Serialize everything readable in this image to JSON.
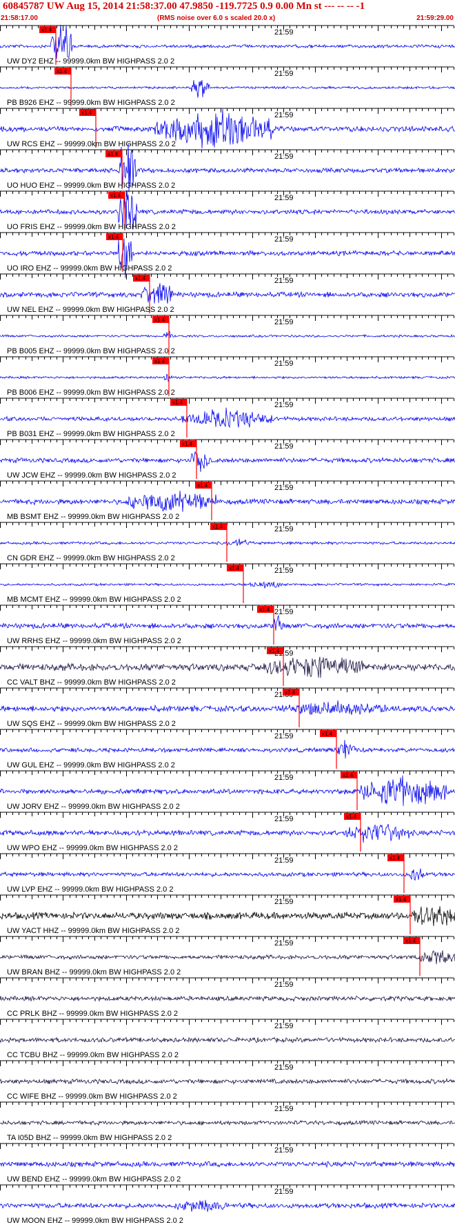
{
  "header": {
    "title": "60845787 UW Aug 15, 2014 21:58:37.00   47.9850 -119.7725  0.9 0.00 Mn st --- -- --  -1",
    "start_time": "21:58:17.00",
    "note": "(RMS noise over 6.0 s scaled 20.0 x)",
    "end_time": "21:59:29.00"
  },
  "colors": {
    "trace_blue": "#0000ee",
    "trace_dark": "#1a1040",
    "trace_black": "#000000",
    "pick_red": "#ff0000",
    "header_red": "#d40000"
  },
  "chart_data": {
    "type": "line",
    "time_marker": "21:59",
    "scale_label": "x1.4",
    "traces": [
      {
        "label": "UW DY2 EHZ -- 99999.0km BW  HIGHPASS  2.0  2",
        "pick_frac": 0.123,
        "burst": [
          0.11,
          0.16,
          2.2
        ],
        "noise": 0.14,
        "color": "blue"
      },
      {
        "label": "PB B926 EHZ -- 99999.0km BW  HIGHPASS  2.0  2",
        "pick_frac": 0.156,
        "burst": [
          0.42,
          0.46,
          1.0
        ],
        "noise": 0.1,
        "color": "blue"
      },
      {
        "label": "UW RCS EHZ -- 99999.0km BW  HIGHPASS  2.0  2",
        "pick_frac": 0.212,
        "burst": [
          0.34,
          0.6,
          1.8
        ],
        "noise": 0.22,
        "color": "blue"
      },
      {
        "label": "UO HUO EHZ -- 99999.0km BW  HIGHPASS  2.0  2",
        "pick_frac": 0.269,
        "burst": [
          0.26,
          0.3,
          3.0
        ],
        "noise": 0.2,
        "color": "blue"
      },
      {
        "label": "UO FRIS EHZ -- 99999.0km BW  HIGHPASS  2.0  2",
        "pick_frac": 0.275,
        "burst": [
          0.26,
          0.3,
          3.0
        ],
        "noise": 0.2,
        "color": "blue"
      },
      {
        "label": "UO IRO EHZ -- 99999.0km BW  HIGHPASS  2.0  2",
        "pick_frac": 0.27,
        "burst": [
          0.26,
          0.29,
          3.0
        ],
        "noise": 0.2,
        "color": "blue"
      },
      {
        "label": "UW NEL EHZ -- 99999.0km BW  HIGHPASS  2.0  2",
        "pick_frac": 0.33,
        "burst": [
          0.31,
          0.38,
          1.0
        ],
        "noise": 0.22,
        "color": "blue"
      },
      {
        "label": "PB B005 EHZ -- 99999.0km BW  HIGHPASS  2.0  2",
        "pick_frac": 0.372,
        "burst": [
          0.36,
          0.38,
          0.5
        ],
        "noise": 0.1,
        "color": "blue"
      },
      {
        "label": "PB B006 EHZ -- 99999.0km BW  HIGHPASS  2.0  2",
        "pick_frac": 0.372,
        "burst": [
          0.36,
          0.38,
          0.5
        ],
        "noise": 0.1,
        "color": "blue"
      },
      {
        "label": "PB B031 EHZ -- 99999.0km BW  HIGHPASS  2.0  2",
        "pick_frac": 0.412,
        "burst": [
          0.4,
          0.6,
          0.8
        ],
        "noise": 0.18,
        "color": "blue"
      },
      {
        "label": "UW JCW EHZ -- 99999.0km BW  HIGHPASS  2.0  2",
        "pick_frac": 0.433,
        "burst": [
          0.42,
          0.46,
          1.3
        ],
        "noise": 0.2,
        "color": "blue"
      },
      {
        "label": "MB BSMT EHZ -- 99999.0km BW  HIGHPASS  2.0  2",
        "pick_frac": 0.466,
        "burst": [
          0.28,
          0.48,
          0.9
        ],
        "noise": 0.22,
        "color": "blue"
      },
      {
        "label": "CN GDR EHZ -- 99999.0km BW  HIGHPASS  2.0  2",
        "pick_frac": 0.5,
        "burst": [
          0.5,
          0.55,
          0.3
        ],
        "noise": 0.12,
        "color": "blue"
      },
      {
        "label": "MB MCMT EHZ -- 99999.0km BW  HIGHPASS  2.0  2",
        "pick_frac": 0.537,
        "burst": [
          0.55,
          0.62,
          0.3
        ],
        "noise": 0.1,
        "color": "blue"
      },
      {
        "label": "UW RRHS EHZ -- 99999.0km BW  HIGHPASS  2.0  2",
        "pick_frac": 0.604,
        "burst": [
          0.6,
          0.62,
          1.3
        ],
        "noise": 0.22,
        "color": "blue"
      },
      {
        "label": "CC VALT BHZ -- 99999.0km BW  HIGHPASS  2.0  2",
        "pick_frac": 0.625,
        "burst": [
          0.58,
          0.8,
          0.9
        ],
        "noise": 0.3,
        "color": "dark"
      },
      {
        "label": "UW SQS EHZ -- 99999.0km BW  HIGHPASS  2.0  2",
        "pick_frac": 0.66,
        "burst": [
          0.62,
          0.85,
          0.5
        ],
        "noise": 0.25,
        "color": "blue"
      },
      {
        "label": "UW GUL EHZ -- 99999.0km BW  HIGHPASS  2.0  2",
        "pick_frac": 0.742,
        "burst": [
          0.74,
          0.78,
          0.8
        ],
        "noise": 0.18,
        "color": "blue"
      },
      {
        "label": "UW JORV EHZ -- 99999.0km BW  HIGHPASS  2.0  2",
        "pick_frac": 0.787,
        "burst": [
          0.79,
          0.99,
          1.4
        ],
        "noise": 0.22,
        "color": "blue"
      },
      {
        "label": "UW WPO EHZ -- 99999.0km BW  HIGHPASS  2.0  2",
        "pick_frac": 0.795,
        "burst": [
          0.76,
          0.9,
          0.9
        ],
        "noise": 0.22,
        "color": "blue"
      },
      {
        "label": "UW LVP EHZ -- 99999.0km BW  HIGHPASS  2.0  2",
        "pick_frac": 0.89,
        "burst": [
          0.9,
          0.93,
          0.6
        ],
        "noise": 0.18,
        "color": "blue"
      },
      {
        "label": "UW YACT HHZ -- 99999.0km BW  HIGHPASS  2.0  2",
        "pick_frac": 0.905,
        "burst": [
          0.9,
          1.0,
          0.9
        ],
        "noise": 0.3,
        "color": "black"
      },
      {
        "label": "UW BRAN BHZ -- 99999.0km BW  HIGHPASS  2.0  2",
        "pick_frac": 0.925,
        "burst": [
          0.92,
          1.0,
          0.7
        ],
        "noise": 0.18,
        "color": "dark"
      },
      {
        "label": "CC PRLK BHZ -- 99999.0km BW  HIGHPASS  2.0  2",
        "pick_frac": null,
        "burst": null,
        "noise": 0.2,
        "color": "dark"
      },
      {
        "label": "CC TCBU BHZ -- 99999.0km BW  HIGHPASS  2.0  2",
        "pick_frac": null,
        "burst": null,
        "noise": 0.2,
        "color": "dark"
      },
      {
        "label": "CC WIFE BHZ -- 99999.0km BW  HIGHPASS  2.0  2",
        "pick_frac": null,
        "burst": null,
        "noise": 0.2,
        "color": "dark"
      },
      {
        "label": "TA I05D BHZ -- 99999.0km BW  HIGHPASS  2.0  2",
        "pick_frac": null,
        "burst": null,
        "noise": 0.18,
        "color": "dark"
      },
      {
        "label": "UW BEND EHZ -- 99999.0km BW  HIGHPASS  2.0  2",
        "pick_frac": null,
        "burst": null,
        "noise": 0.22,
        "color": "blue"
      },
      {
        "label": "UW MOON EHZ -- 99999.0km BW  HIGHPASS  2.0  2",
        "pick_frac": null,
        "burst": [
          0.38,
          0.5,
          0.4
        ],
        "noise": 0.22,
        "color": "blue"
      }
    ]
  }
}
